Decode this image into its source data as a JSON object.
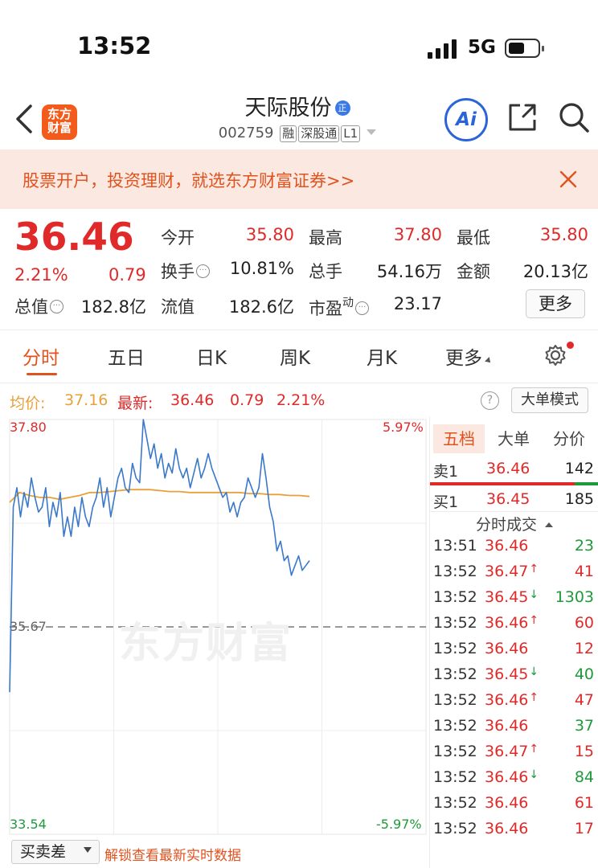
{
  "status_bar": {
    "time": "13:52",
    "network": "5G"
  },
  "header": {
    "back_icon": "chevron-left-icon",
    "brand_logo": "东方\n财富",
    "stock_name": "天际股份",
    "verified_badge": "正",
    "code": "002759",
    "tags": [
      "融",
      "深股通",
      "L1"
    ],
    "ai_label": "Ai",
    "share_icon": "share-icon",
    "search_icon": "search-icon"
  },
  "banner": {
    "text": "股票开户，投资理财，就选东方财富证券>>"
  },
  "quote": {
    "price": "36.46",
    "change_pct": "2.21%",
    "change_abs": "0.79",
    "open_label": "今开",
    "open": "35.80",
    "high_label": "最高",
    "high": "37.80",
    "low_label": "最低",
    "low": "35.80",
    "turnover_label": "换手",
    "turnover": "10.81%",
    "volume_label": "总手",
    "volume": "54.16万",
    "amount_label": "金额",
    "amount": "20.13亿",
    "mktcap_label": "总值",
    "mktcap": "182.8亿",
    "float_label": "流值",
    "float_cap": "182.6亿",
    "pe_label": "市盈",
    "pe_sup": "动",
    "pe": "23.17",
    "more_label": "更多"
  },
  "tabs": [
    {
      "label": "分时",
      "active": true
    },
    {
      "label": "五日"
    },
    {
      "label": "日K"
    },
    {
      "label": "周K"
    },
    {
      "label": "月K"
    },
    {
      "label": "更多"
    }
  ],
  "legend": {
    "avg_label": "均价:",
    "avg": "37.16",
    "latest_label": "最新:",
    "latest": "36.46",
    "chg": "0.79",
    "pct": "2.21%",
    "help": "?",
    "bigorder_label": "大单模式"
  },
  "chart_data": {
    "type": "line",
    "ylim": [
      33.54,
      37.8
    ],
    "y_top_label": "37.80",
    "y_mid_label": "35.67",
    "y_bottom_label": "33.54",
    "pct_top_label": "5.97%",
    "pct_bottom_label": "-5.97%",
    "watermark": "东方财富",
    "series": [
      {
        "values": [
          35.0,
          36.9,
          37.1,
          36.8,
          37.05,
          36.9,
          37.2,
          37.0,
          36.85,
          36.9,
          37.1,
          36.7,
          36.95,
          36.8,
          37.05,
          36.6,
          36.8,
          36.6,
          36.9,
          36.7,
          37.0,
          36.8,
          36.7,
          36.9,
          37.0,
          37.2,
          36.9,
          37.1,
          36.8,
          37.0,
          37.2,
          37.3,
          37.1,
          37.05,
          37.35,
          37.2,
          37.15,
          37.8,
          37.6,
          37.4,
          37.55,
          37.3,
          37.45,
          37.2,
          37.35,
          37.25,
          37.5,
          37.3,
          37.2,
          37.3,
          37.1,
          37.25,
          37.4,
          37.2,
          37.3,
          37.45,
          37.3,
          37.2,
          37.1,
          37.0,
          37.05,
          36.85,
          36.95,
          36.8,
          36.95,
          37.0,
          37.2,
          37.1,
          37.0,
          37.1,
          37.45,
          37.2,
          36.9,
          36.75,
          36.45,
          36.55,
          36.35,
          36.4,
          36.2,
          36.3,
          36.4,
          36.25,
          36.3,
          36.35
        ]
      },
      {
        "values": [
          36.95,
          37.05,
          37.02,
          37.0,
          37.0,
          36.98,
          37.0,
          37.02,
          37.05,
          37.05,
          37.06,
          37.07,
          37.08,
          37.08,
          37.08,
          37.07,
          37.06,
          37.06,
          37.05,
          37.05,
          37.05,
          37.05,
          37.05,
          37.05,
          37.04,
          37.04,
          37.03,
          37.03,
          37.02,
          37.02,
          37.01
        ]
      }
    ]
  },
  "bottom_bar": {
    "indicator": "买卖差",
    "unlock_text": "解锁查看最新实时数据"
  },
  "side_panel": {
    "tabs": [
      "五档",
      "大单",
      "分价"
    ],
    "ask": {
      "label": "卖1",
      "price": "36.46",
      "vol": "142"
    },
    "bid": {
      "label": "买1",
      "price": "36.45",
      "vol": "185"
    },
    "trades_header": "分时成交",
    "trades": [
      {
        "time": "13:51",
        "price": "36.46",
        "arrow": "",
        "vol": "23",
        "vol_color": "green"
      },
      {
        "time": "13:52",
        "price": "36.47",
        "arrow": "↑",
        "vol": "41",
        "vol_color": "red"
      },
      {
        "time": "13:52",
        "price": "36.45",
        "arrow": "↓",
        "vol": "1303",
        "vol_color": "green"
      },
      {
        "time": "13:52",
        "price": "36.46",
        "arrow": "↑",
        "vol": "60",
        "vol_color": "red"
      },
      {
        "time": "13:52",
        "price": "36.46",
        "arrow": "",
        "vol": "12",
        "vol_color": "red"
      },
      {
        "time": "13:52",
        "price": "36.45",
        "arrow": "↓",
        "vol": "40",
        "vol_color": "green"
      },
      {
        "time": "13:52",
        "price": "36.46",
        "arrow": "↑",
        "vol": "47",
        "vol_color": "red"
      },
      {
        "time": "13:52",
        "price": "36.46",
        "arrow": "",
        "vol": "37",
        "vol_color": "green"
      },
      {
        "time": "13:52",
        "price": "36.47",
        "arrow": "↑",
        "vol": "15",
        "vol_color": "red"
      },
      {
        "time": "13:52",
        "price": "36.46",
        "arrow": "↓",
        "vol": "84",
        "vol_color": "green"
      },
      {
        "time": "13:52",
        "price": "36.46",
        "arrow": "",
        "vol": "61",
        "vol_color": "red"
      },
      {
        "time": "13:52",
        "price": "36.46",
        "arrow": "",
        "vol": "17",
        "vol_color": "red"
      }
    ]
  },
  "colors": {
    "up": "#e02a2a",
    "down": "#1f9a3a",
    "accent": "#e0521e",
    "price_line": "#3a78c9",
    "avg_line": "#e8a03a"
  }
}
